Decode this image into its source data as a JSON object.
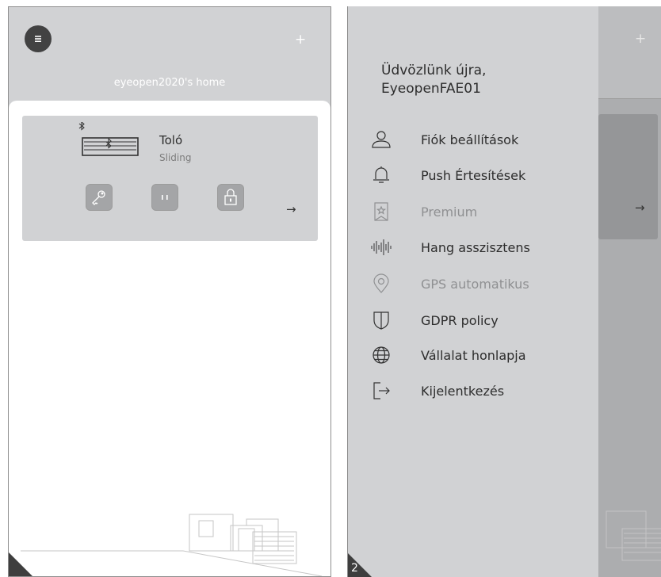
{
  "screen1": {
    "add_label": "+",
    "home_title": "eyeopen2020's home",
    "device": {
      "name": "Toló",
      "type": "Sliding",
      "arrow": "→"
    },
    "icons": [
      "menu-icon",
      "bluetooth-icon",
      "key-icon",
      "pause-icon",
      "lock-icon"
    ]
  },
  "screen2": {
    "add_label": "+",
    "welcome_line1": "Üdvözlünk újra,",
    "welcome_line2": "EyeopenFAE01",
    "arrow": "→",
    "page_number": "2",
    "menu": [
      {
        "label": "Fiók  beállítások",
        "icon": "user-icon",
        "enabled": true
      },
      {
        "label": "Push  Értesítések",
        "icon": "bell-icon",
        "enabled": true
      },
      {
        "label": "Premium",
        "icon": "premium-star-icon",
        "enabled": false
      },
      {
        "label": "Hang asszisztens",
        "icon": "voice-wave-icon",
        "enabled": true
      },
      {
        "label": "GPS automatikus",
        "icon": "location-pin-icon",
        "enabled": false
      },
      {
        "label": "GDPR policy",
        "icon": "shield-icon",
        "enabled": true
      },
      {
        "label": "Vállalat honlapja",
        "icon": "globe-icon",
        "enabled": true
      },
      {
        "label": "Kijelentkezés",
        "icon": "logout-icon",
        "enabled": true
      }
    ]
  },
  "colors": {
    "header_bg": "#d1d2d4",
    "card_bg": "#d1d2d4",
    "button_bg": "#a4a5a7",
    "hamburger_bg": "#424242",
    "text_dark": "#2d2d2d",
    "text_disabled": "#8f9092"
  }
}
